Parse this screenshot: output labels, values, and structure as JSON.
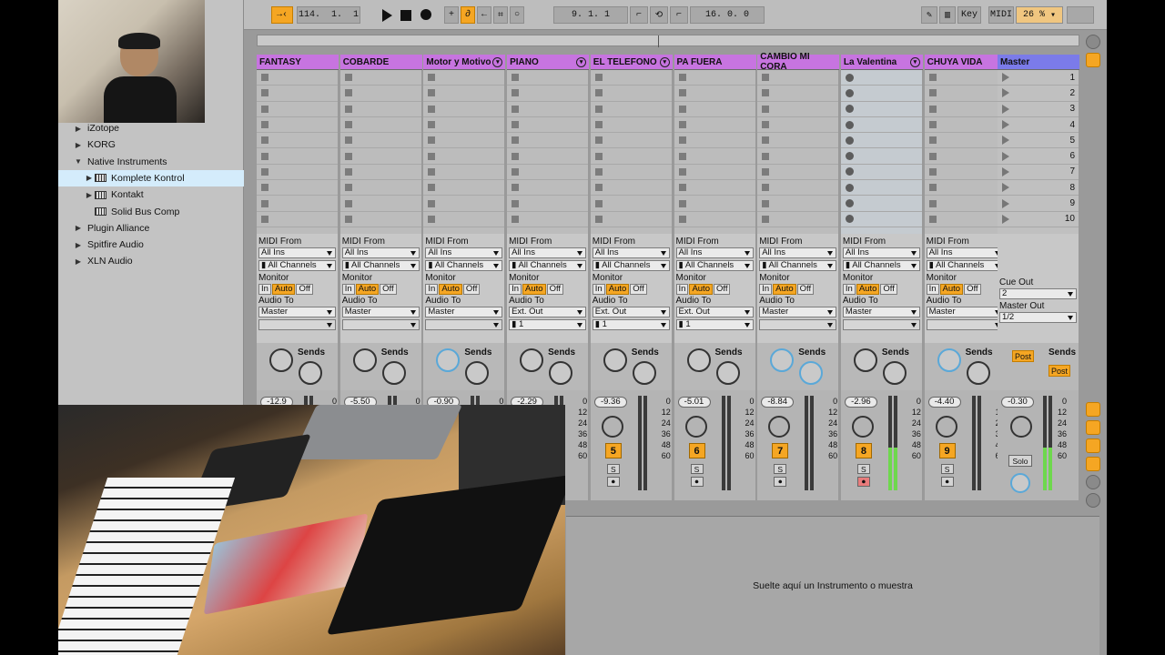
{
  "transport": {
    "tempo_bpm": "114.",
    "tempo_a": "1.",
    "tempo_b": "1",
    "position": "9.  1.  1",
    "loop_length": "16.  0.  0",
    "key_label": "Key",
    "midi_label": "MIDI",
    "cpu": "26 %"
  },
  "browser": {
    "items": [
      {
        "label": "iZotope",
        "arrow": "▶",
        "selected": false,
        "plugin": false
      },
      {
        "label": "KORG",
        "arrow": "▶",
        "selected": false,
        "plugin": false
      },
      {
        "label": "Native Instruments",
        "arrow": "▼",
        "selected": false,
        "plugin": false
      },
      {
        "label": "Komplete Kontrol",
        "arrow": "▶",
        "selected": true,
        "plugin": true
      },
      {
        "label": "Kontakt",
        "arrow": "▶",
        "selected": false,
        "plugin": true
      },
      {
        "label": "Solid Bus Comp",
        "arrow": "",
        "selected": false,
        "plugin": true
      },
      {
        "label": "Plugin Alliance",
        "arrow": "▶",
        "selected": false,
        "plugin": false
      },
      {
        "label": "Spitfire Audio",
        "arrow": "▶",
        "selected": false,
        "plugin": false
      },
      {
        "label": "XLN Audio",
        "arrow": "▶",
        "selected": false,
        "plugin": false
      }
    ]
  },
  "tracks": [
    {
      "name": "FANTASY",
      "color": "#c774e0",
      "fold": false,
      "audio_to": "Master",
      "sub": "",
      "vol": "-12.9",
      "num": "",
      "meter": 0,
      "armed": false
    },
    {
      "name": "COBARDE",
      "color": "#c774e0",
      "fold": false,
      "audio_to": "Master",
      "sub": "",
      "vol": "-5.50",
      "num": "",
      "meter": 0,
      "armed": false
    },
    {
      "name": "Motor y Motivo",
      "color": "#c774e0",
      "fold": true,
      "audio_to": "Master",
      "sub": "",
      "vol": "-0.90",
      "num": "",
      "meter": 0,
      "armed": false
    },
    {
      "name": "PIANO",
      "color": "#c774e0",
      "fold": true,
      "audio_to": "Ext. Out",
      "sub": "1",
      "vol": "-2.29",
      "num": "",
      "meter": 0,
      "armed": false
    },
    {
      "name": "EL TELEFONO",
      "color": "#c774e0",
      "fold": true,
      "audio_to": "Ext. Out",
      "sub": "1",
      "vol": "-9.36",
      "num": "5",
      "meter": 0,
      "armed": false
    },
    {
      "name": "PA FUERA",
      "color": "#c774e0",
      "fold": false,
      "audio_to": "Ext. Out",
      "sub": "1",
      "vol": "-5.01",
      "num": "6",
      "meter": 0,
      "armed": false
    },
    {
      "name": "CAMBIO MI CORA",
      "color": "#c774e0",
      "fold": false,
      "audio_to": "Master",
      "sub": "",
      "vol": "-8.84",
      "num": "7",
      "meter": 0,
      "armed": false
    },
    {
      "name": "La Valentina",
      "color": "#c774e0",
      "fold": true,
      "audio_to": "Master",
      "sub": "",
      "vol": "-2.96",
      "num": "8",
      "meter": 0.45,
      "armed": true
    },
    {
      "name": "CHUYA VIDA",
      "color": "#c774e0",
      "fold": false,
      "audio_to": "Master",
      "sub": "",
      "vol": "-4.40",
      "num": "9",
      "meter": 0,
      "armed": false
    }
  ],
  "io": {
    "midi_from": "MIDI From",
    "all_ins": "All Ins",
    "all_channels": "All Channels",
    "monitor": "Monitor",
    "in": "In",
    "auto": "Auto",
    "off": "Off",
    "audio_to": "Audio To",
    "sends": "Sends",
    "solo_s": "S"
  },
  "master": {
    "name": "Master",
    "scene_numbers": [
      "1",
      "2",
      "3",
      "4",
      "5",
      "6",
      "7",
      "8",
      "9",
      "10"
    ],
    "cue_out_label": "Cue Out",
    "cue_out": "2",
    "master_out_label": "Master Out",
    "master_out": "1/2",
    "sends": "Sends",
    "post": "Post",
    "vol": "-0.30",
    "solo": "Solo",
    "meter": 0.45
  },
  "meter_scale": [
    "0",
    "12",
    "24",
    "36",
    "48",
    "60"
  ],
  "detail": {
    "drop_hint": "Suelte aquí un Instrumento o muestra"
  }
}
